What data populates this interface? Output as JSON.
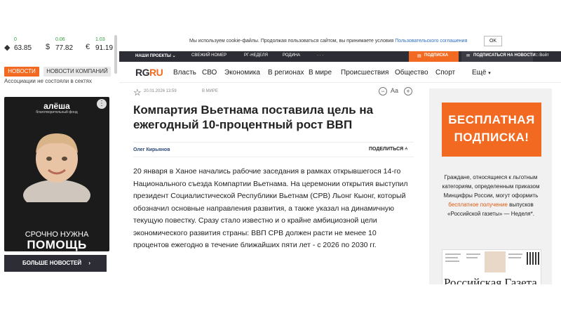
{
  "tickers": [
    {
      "icon": "oil-drop-icon",
      "symbol": "💧",
      "change": "0",
      "value": "63.85"
    },
    {
      "icon": "dollar-icon",
      "symbol": "$",
      "change": "0.06",
      "value": "77.82"
    },
    {
      "icon": "euro-icon",
      "symbol": "€",
      "change": "1.03",
      "value": "91.19"
    }
  ],
  "sidebar": {
    "tab_news": "НОВОСТИ",
    "tab_company": "НОВОСТИ КОМПАНИЙ",
    "cut_text": "Ассоциации не состояли в сектях",
    "ad": {
      "brand": "алёша",
      "brand_sub": "благотворительный фонд",
      "urgent": "СРОЧНО НУЖНА",
      "help": "ПОМОЩЬ"
    },
    "more_news": "БОЛЬШЕ НОВОСТЕЙ"
  },
  "cookie": {
    "text": "Мы используем cookie-файлы. Продолжая пользоваться сайтом, вы принимаете условия",
    "link": "Пользовательского соглашения",
    "ok": "OK"
  },
  "topnav": {
    "projects": "НАШИ ПРОЕКТЫ",
    "issue": "СВЕЖИЙ НОМЕР",
    "week": "РГ-НЕДЕЛЯ",
    "rodina": "РОДИНА",
    "dots": "· · ·",
    "subscribe": "ПОДПИСКА",
    "news_subscribe": "ПОДПИСАТЬСЯ НА НОВОСТИ",
    "login": "Войт"
  },
  "mainnav": {
    "logo_rg": "RG",
    "logo_ru": "RU",
    "items": [
      "Власть",
      "СВО",
      "Экономика",
      "В регионах",
      "В мире",
      "Происшествия",
      "Общество",
      "Спорт"
    ],
    "more": "Ещё"
  },
  "article": {
    "date": "20.01.2026 13:59",
    "rubric": "В МИРЕ",
    "aa": "Aa",
    "headline": "Компартия Вьетнама поставила цель на ежегодный 10-процентный рост ВВП",
    "author": "Олег Кирьянов",
    "share": "ПОДЕЛИТЬСЯ",
    "lead": "20 января в Ханое начались рабочие заседания в рамках открывшегося 14-го Национального съезда Компартии Вьетнама. На церемонии открытия выступил президент Социалистической Республики Вьетнам (СРВ) Льонг Кыонг, который обозначил основные направления развития, а также указал на динамичную текущую повестку. Сразу стало известно и о крайне амбициозной цели экономического развития страны: ВВП СРВ должен расти не менее 10 процентов ежегодно в течение ближайших пяти лет - с 2026 по 2030 гг."
  },
  "promo": {
    "title": "БЕСПЛАТНАЯ ПОДПИСКА!",
    "text_1": "Граждане, относящиеся к льготным категориям, определенным приказом Минцифры России, могут оформить",
    "link": "бесплатное получение",
    "text_2": "выпусков «Российской газеты» — Неделя*.",
    "masthead": "Российская Газета"
  },
  "colors": {
    "accent": "#f26a21",
    "dark_nav": "#2d2d35",
    "link": "#2d6cbf",
    "positive": "#2e9d3a"
  }
}
